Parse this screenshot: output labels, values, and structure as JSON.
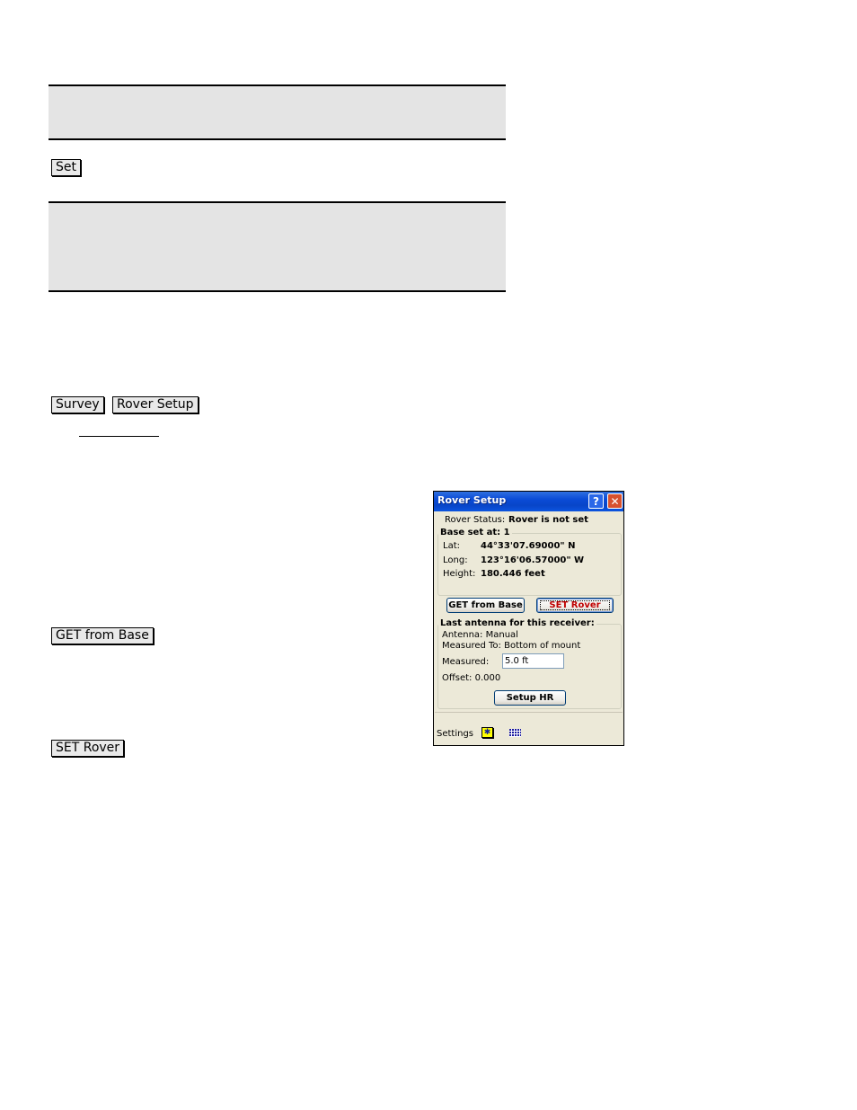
{
  "document": {
    "buttons": {
      "set": "Set",
      "survey": "Survey",
      "rover_setup": "Rover Setup",
      "get_from_base": "GET from Base",
      "set_rover": "SET Rover"
    }
  },
  "device_window": {
    "title": "Rover Setup",
    "help_icon": "?",
    "close_icon": "✕",
    "rover_status_label": "Rover Status:",
    "rover_status_value": "Rover is not set",
    "base_group_label": "Base set at: 1",
    "lat_label": "Lat:",
    "lat_value": "44°33'07.69000\" N",
    "long_label": "Long:",
    "long_value": "123°16'06.57000\" W",
    "height_label": "Height:",
    "height_value": "180.446 feet",
    "get_from_base_button": "GET from Base",
    "set_rover_button": "SET Rover",
    "antenna_group_label": "Last antenna for this receiver:",
    "antenna_text": "Antenna: Manual",
    "measured_to_text": "Measured To: Bottom of mount",
    "measured_label": "Measured:",
    "measured_value": "5.0 ft",
    "offset_text": "Offset: 0.000",
    "setup_hr_button": "Setup HR",
    "settings_label": "Settings",
    "settings_icon_glyph": "✱"
  }
}
